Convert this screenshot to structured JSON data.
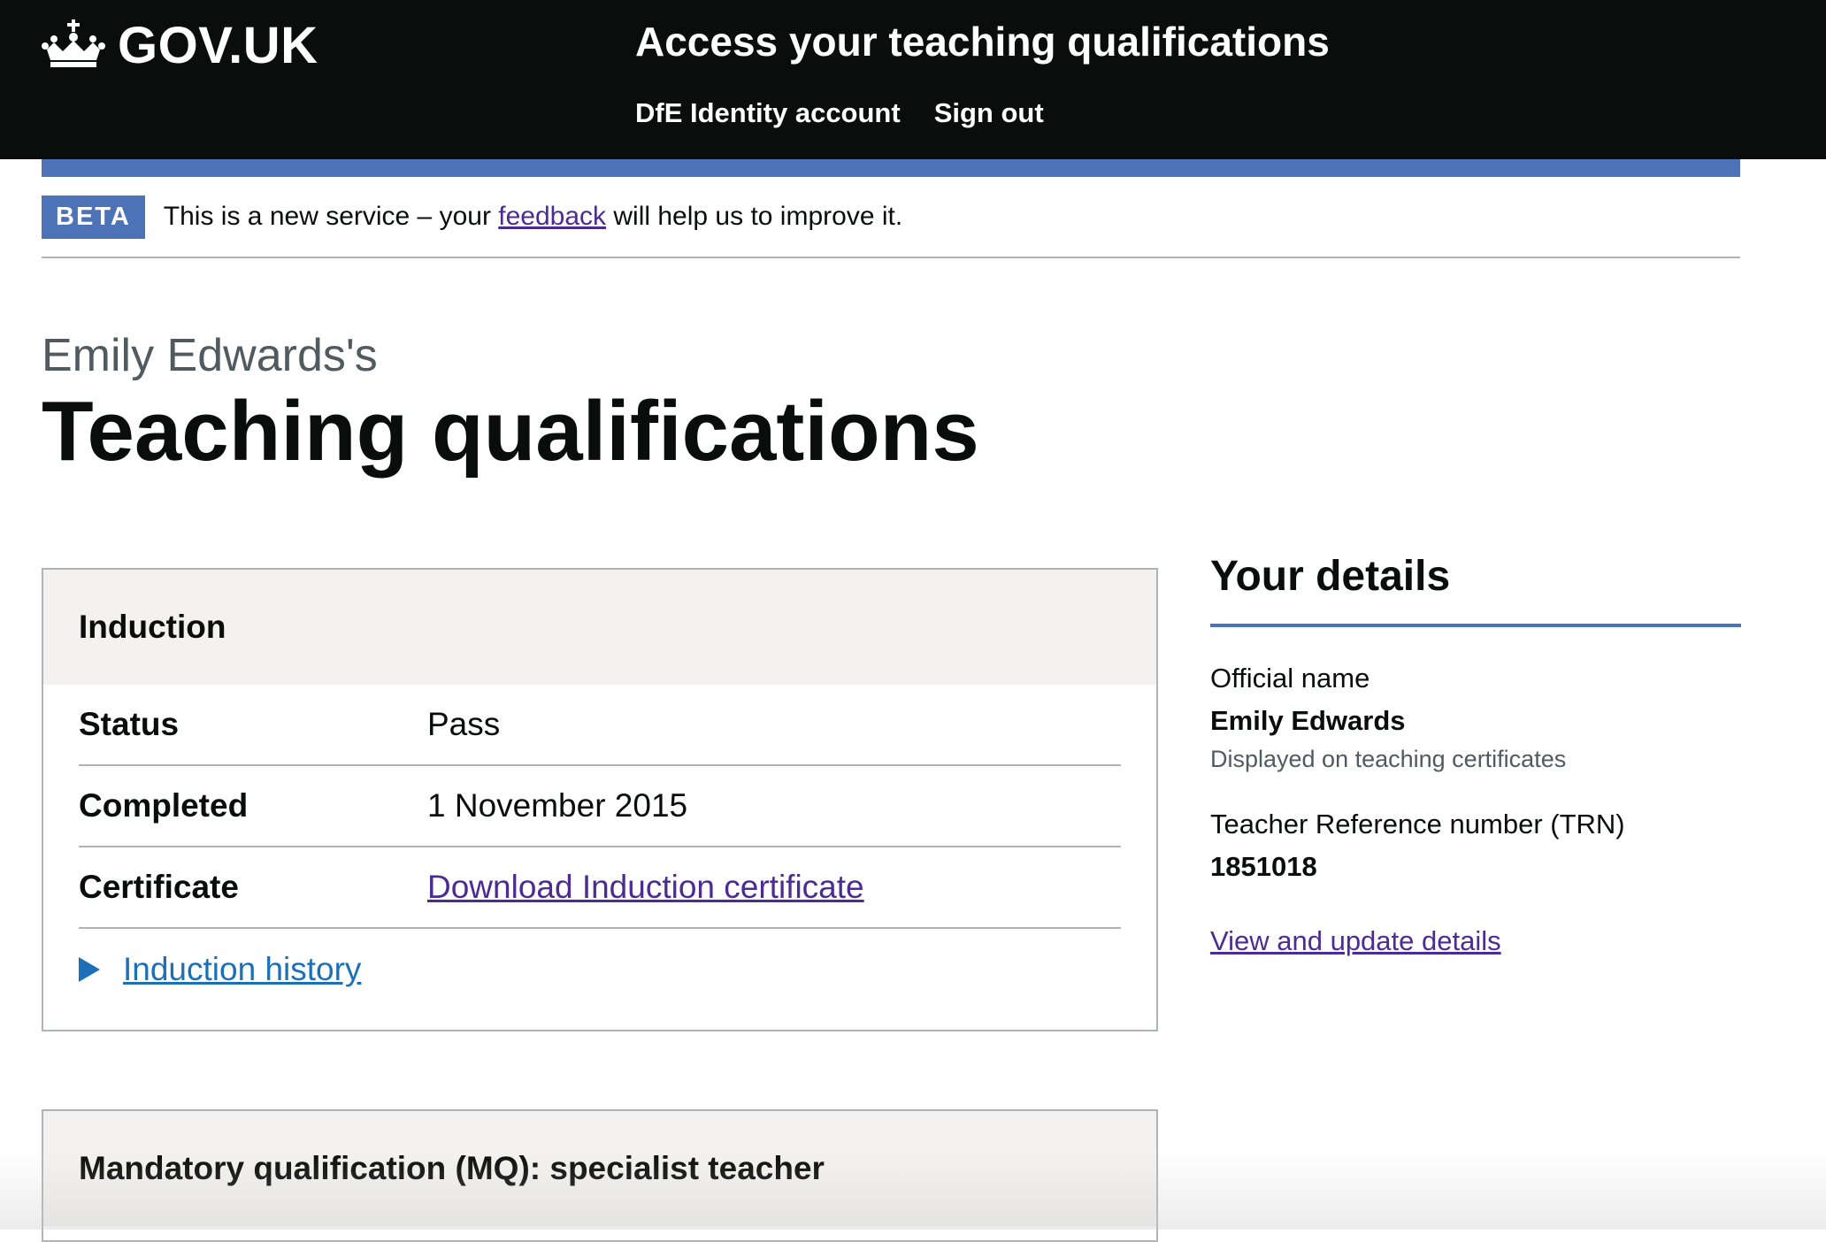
{
  "header": {
    "logo_text": "GOV.UK",
    "service_name": "Access your teaching qualifications",
    "nav": [
      "DfE Identity account",
      "Sign out"
    ]
  },
  "phase_banner": {
    "tag": "BETA",
    "text_before": "This is a new service – your ",
    "link": "feedback",
    "text_after": " will help us to improve it."
  },
  "page": {
    "caption": "Emily Edwards's",
    "title": "Teaching qualifications"
  },
  "induction": {
    "heading": "Induction",
    "rows": [
      {
        "key": "Status",
        "value": "Pass"
      },
      {
        "key": "Completed",
        "value": "1 November 2015"
      },
      {
        "key": "Certificate",
        "value": "Download Induction certificate"
      }
    ],
    "history_link": "Induction history"
  },
  "mq": {
    "heading": "Mandatory qualification (MQ): specialist teacher"
  },
  "your_details": {
    "heading": "Your details",
    "official_name_label": "Official name",
    "official_name_value": "Emily Edwards",
    "official_name_hint": "Displayed on teaching certificates",
    "trn_label": "Teacher Reference number (TRN)",
    "trn_value": "1851018",
    "update_link": "View and update details"
  },
  "colors": {
    "header_bg": "#0b0c0c",
    "brand_blue": "#4c72b8",
    "link_visited": "#4c2c92",
    "link": "#1d70b8"
  }
}
